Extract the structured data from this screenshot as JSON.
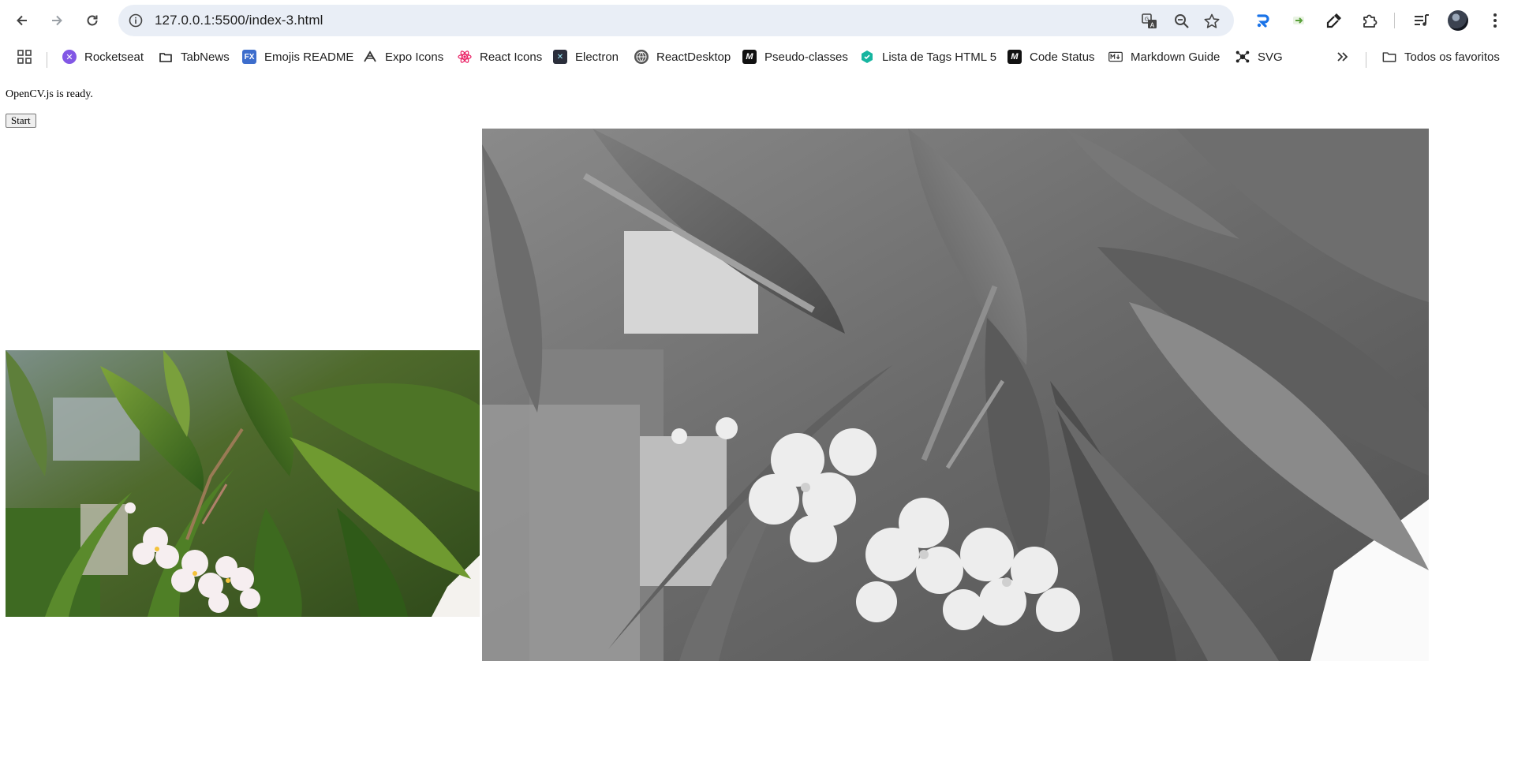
{
  "browser": {
    "url": "127.0.0.1:5500/index-3.html",
    "icons": {
      "back": "arrow-left-icon",
      "forward": "arrow-right-icon",
      "reload": "reload-icon",
      "site_info": "info-icon",
      "translate": "translate-icon",
      "zoom": "zoom-out-icon",
      "bookmark": "star-icon",
      "extensions": "puzzle-icon",
      "media": "media-queue-icon",
      "menu": "kebab-menu-icon",
      "apps": "apps-grid-icon",
      "overflow": "chevron-double-right-icon",
      "folder": "folder-icon"
    }
  },
  "bookmarks": {
    "items": [
      {
        "label": "Rocketseat",
        "color": "#8257e5"
      },
      {
        "label": "TabNews",
        "color": "#1f1f1f"
      },
      {
        "label": "Emojis README",
        "color": "#3d6dcc"
      },
      {
        "label": "Expo Icons",
        "color": "#444444"
      },
      {
        "label": "React Icons",
        "color": "#e91e63"
      },
      {
        "label": "Electron",
        "color": "#2b2e3b"
      },
      {
        "label": "ReactDesktop",
        "color": "#555555"
      },
      {
        "label": "Pseudo-classes",
        "color": "#111111"
      },
      {
        "label": "Lista de Tags HTML 5",
        "color": "#16b5a0"
      },
      {
        "label": "Code Status",
        "color": "#111111"
      },
      {
        "label": "Markdown Guide",
        "color": "#333333"
      },
      {
        "label": "SVG",
        "color": "#222222"
      }
    ],
    "all_bookmarks": "Todos os favoritos"
  },
  "page": {
    "status": "OpenCV.js is ready.",
    "start_label": "Start"
  }
}
